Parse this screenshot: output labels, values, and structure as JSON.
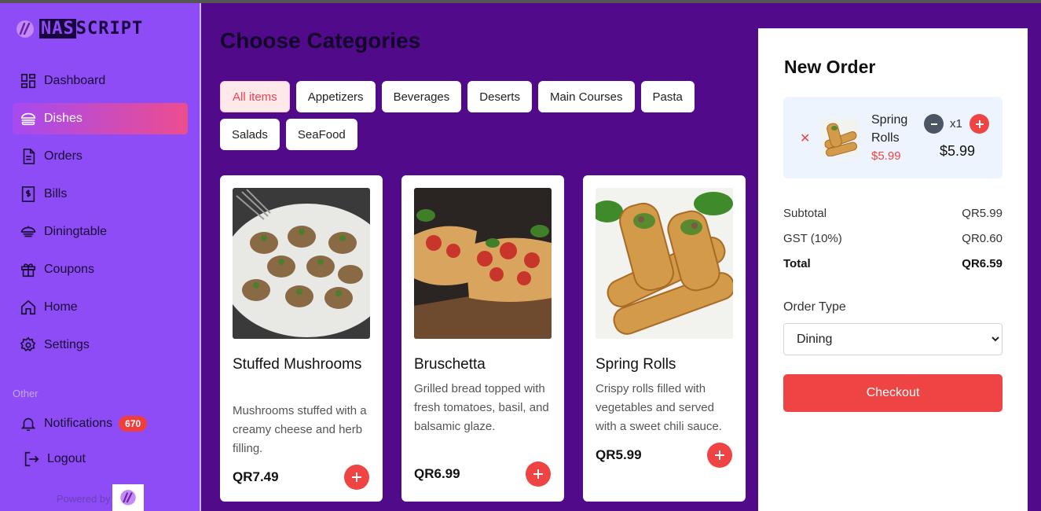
{
  "brand": {
    "prefix": "NAS",
    "suffix": "SCRIPT"
  },
  "sidebar": {
    "items": [
      {
        "label": "Dashboard",
        "icon": "dashboard-icon"
      },
      {
        "label": "Dishes",
        "icon": "dish-icon",
        "active": true
      },
      {
        "label": "Orders",
        "icon": "orders-icon"
      },
      {
        "label": "Bills",
        "icon": "bills-icon"
      },
      {
        "label": "Diningtable",
        "icon": "diningtable-icon"
      },
      {
        "label": "Coupons",
        "icon": "gift-icon"
      },
      {
        "label": "Home",
        "icon": "home-icon"
      },
      {
        "label": "Settings",
        "icon": "gear-icon"
      }
    ],
    "other_label": "Other",
    "notifications": {
      "label": "Notifications",
      "count": "670"
    },
    "logout": "Logout",
    "powered_by": "Powered by"
  },
  "main": {
    "title": "Choose Categories",
    "categories": [
      "All items",
      "Appetizers",
      "Beverages",
      "Deserts",
      "Main Courses",
      "Pasta",
      "Salads",
      "SeaFood"
    ],
    "active_category": "All items",
    "dishes": [
      {
        "name": "Stuffed Mushrooms",
        "description": "Mushrooms stuffed with a creamy cheese and herb filling.",
        "price": "QR7.49"
      },
      {
        "name": "Bruschetta",
        "description": "Grilled bread topped with fresh tomatoes, basil, and balsamic glaze.",
        "price": "QR6.99"
      },
      {
        "name": "Spring Rolls",
        "description": "Crispy rolls filled with vegetables and served with a sweet chili sauce.",
        "price": "QR5.99"
      }
    ]
  },
  "order": {
    "title": "New Order",
    "item": {
      "name": "Spring Rolls",
      "unit_price": "$5.99",
      "quantity": "x1",
      "line_total": "$5.99"
    },
    "summary": {
      "subtotal_label": "Subtotal",
      "subtotal": "QR5.99",
      "gst_label": "GST (10%)",
      "gst": "QR0.60",
      "total_label": "Total",
      "total": "QR6.59"
    },
    "order_type_label": "Order Type",
    "order_type_value": "Dining",
    "checkout_label": "Checkout"
  },
  "colors": {
    "sidebar": "#8e4cf6",
    "main_bg": "#500a8a",
    "accent": "#ef4444",
    "active_gradient_start": "#a64af0",
    "active_gradient_end": "#ec4d8e"
  }
}
